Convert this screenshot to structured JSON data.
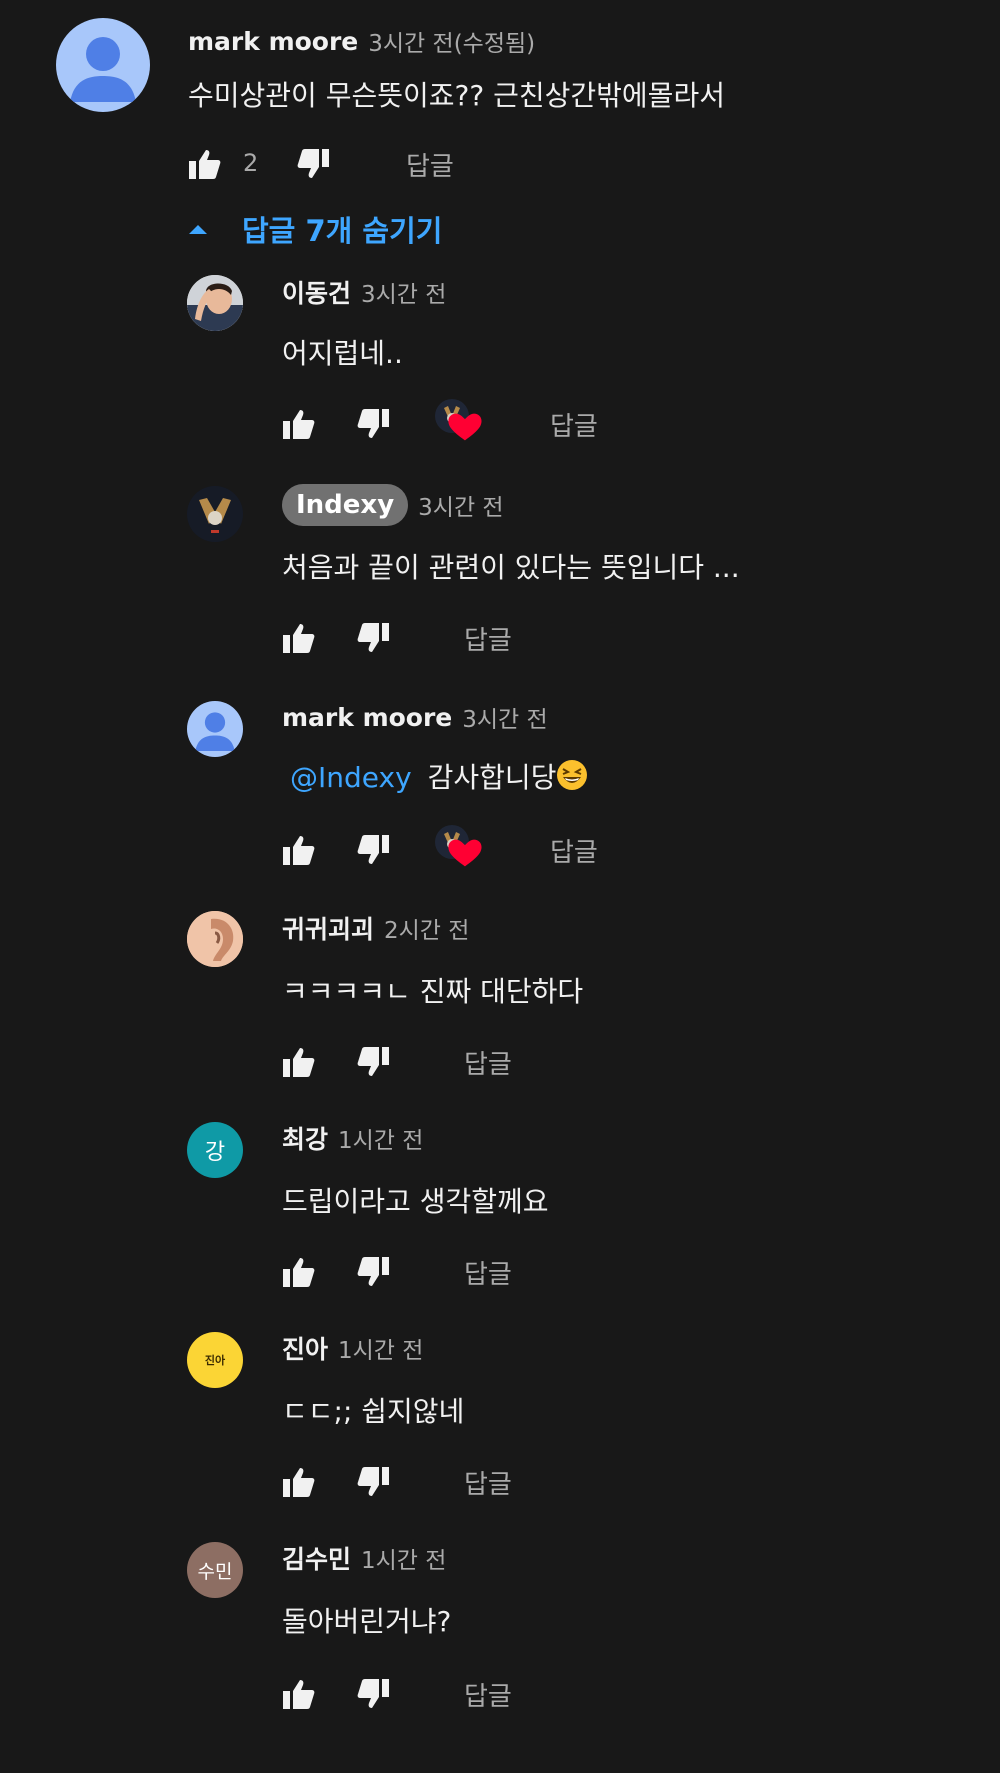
{
  "colors": {
    "background": "#181818",
    "text_primary": "#f1f1f1",
    "text_secondary": "#aaaaaa",
    "link_blue": "#3ea6ff",
    "heart_red": "#ff0033",
    "badge_gray": "#717171"
  },
  "top_comment": {
    "author": "mark moore",
    "time": "3시간 전(수정됨)",
    "text": "수미상관이 무슨뜻이죠?? 근친상간밖에몰라서",
    "like_count": "2",
    "reply_label": "답글",
    "avatar_icon": "default-person-icon"
  },
  "hide_replies_label": "답글 7개 숨기기",
  "replies": [
    {
      "author": "이동건",
      "time": "3시간 전",
      "text": "어지럽네..",
      "reply_label": "답글",
      "creator_hearted": true,
      "avatar_icon": "photo-man-icon"
    },
    {
      "author": "Indexy",
      "time": "3시간 전",
      "text": "처음과 끝이 관련이 있다는 뜻입니다 ...",
      "reply_label": "답글",
      "creator_hearted": false,
      "avatar_icon": "channel-logo-icon"
    },
    {
      "author": "mark moore",
      "time": "3시간 전",
      "mention": "@Indexy",
      "text": "감사합니당",
      "reply_label": "답글",
      "creator_hearted": true,
      "avatar_icon": "default-person-icon"
    },
    {
      "author": "귀귀괴괴",
      "time": "2시간 전",
      "text": "ㅋㅋㅋㅋㄴ 진짜 대단하다",
      "reply_label": "답글",
      "creator_hearted": false,
      "avatar_icon": "ear-photo-icon"
    },
    {
      "author": "최강",
      "time": "1시간 전",
      "text": "드립이라고 생각할께요",
      "reply_label": "답글",
      "creator_hearted": false,
      "avatar_letter": "강",
      "avatar_color": "#0f9aa6"
    },
    {
      "author": "진아",
      "time": "1시간 전",
      "text": "ㄷㄷ;; 쉽지않네",
      "reply_label": "답글",
      "creator_hearted": false,
      "avatar_letter": "진아",
      "avatar_color": "#fbd535"
    },
    {
      "author": "김수민",
      "time": "1시간 전",
      "text": "돌아버린거냐?",
      "reply_label": "답글",
      "creator_hearted": false,
      "avatar_letter": "수민",
      "avatar_color": "#8d6e63"
    }
  ]
}
